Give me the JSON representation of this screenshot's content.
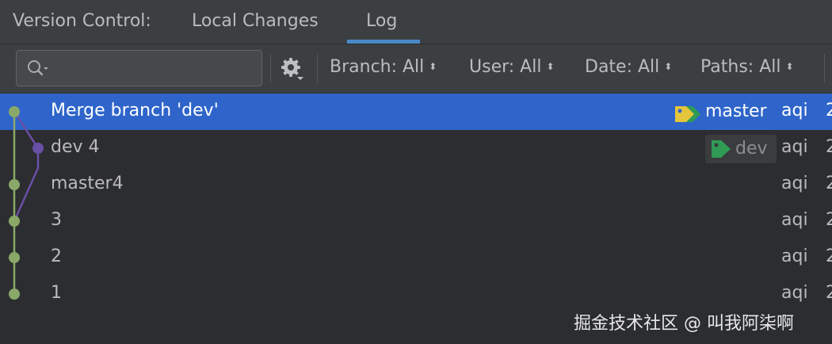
{
  "tabbar": {
    "title": "Version Control:",
    "tabs": [
      {
        "label": "Local Changes",
        "active": false
      },
      {
        "label": "Log",
        "active": true
      }
    ]
  },
  "toolbar": {
    "search_placeholder": "",
    "filters": [
      {
        "label": "Branch: All"
      },
      {
        "label": "User: All"
      },
      {
        "label": "Date: All"
      },
      {
        "label": "Paths: All"
      }
    ]
  },
  "commits": [
    {
      "message": "Merge branch 'dev'",
      "author": "aqi",
      "date_fragment": "2",
      "selected": true
    },
    {
      "message": "dev 4",
      "author": "aqi",
      "date_fragment": "2",
      "selected": false
    },
    {
      "message": "master4",
      "author": "aqi",
      "date_fragment": "2",
      "selected": false
    },
    {
      "message": "3",
      "author": "aqi",
      "date_fragment": "2",
      "selected": false
    },
    {
      "message": "2",
      "author": "aqi",
      "date_fragment": "2",
      "selected": false
    },
    {
      "message": "1",
      "author": "aqi",
      "date_fragment": "2",
      "selected": false
    }
  ],
  "refs": {
    "master": "master",
    "dev": "dev"
  },
  "colors": {
    "selection": "#2f65ca",
    "master_branch": "#8aa868",
    "dev_branch": "#6a4fa6",
    "tag_yellow": "#e5c53b",
    "tag_green": "#2f9b55"
  },
  "watermark": "掘金技术社区 @ 叫我阿柒啊"
}
